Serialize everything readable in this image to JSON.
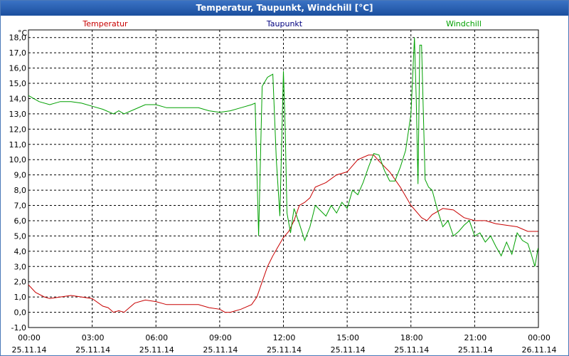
{
  "window": {
    "title": "Temperatur, Taupunkt, Windchill [°C]"
  },
  "colors": {
    "temperatur": "#c80000",
    "taupunkt": "#00007f",
    "windchill": "#00a000",
    "grid": "#000000"
  },
  "chart_data": {
    "type": "line",
    "title": "Temperatur, Taupunkt, Windchill [°C]",
    "ylabel": "°C",
    "ylim": [
      -1,
      18.5
    ],
    "grid": true,
    "legend": "top",
    "y_ticks": [
      "-1,0",
      "0,0",
      "1,0",
      "2,0",
      "3,0",
      "4,0",
      "5,0",
      "6,0",
      "7,0",
      "8,0",
      "9,0",
      "10,0",
      "11,0",
      "12,0",
      "13,0",
      "14,0",
      "15,0",
      "16,0",
      "17,0",
      "18,0"
    ],
    "x_ticks": [
      {
        "time": "00:00",
        "date": "25.11.14"
      },
      {
        "time": "03:00",
        "date": "25.11.14"
      },
      {
        "time": "06:00",
        "date": "25.11.14"
      },
      {
        "time": "09:00",
        "date": "25.11.14"
      },
      {
        "time": "12:00",
        "date": "25.11.14"
      },
      {
        "time": "15:00",
        "date": "25.11.14"
      },
      {
        "time": "18:00",
        "date": "25.11.14"
      },
      {
        "time": "21:00",
        "date": "25.11.14"
      },
      {
        "time": "00:00",
        "date": "26.11.14"
      }
    ],
    "series": [
      {
        "name": "Temperatur",
        "points": [
          [
            "25.11.14 00:00",
            1.8
          ],
          [
            "25.11.14 00:20",
            1.3
          ],
          [
            "25.11.14 00:45",
            1.0
          ],
          [
            "25.11.14 01:00",
            0.9
          ],
          [
            "25.11.14 01:30",
            1.0
          ],
          [
            "25.11.14 02:00",
            1.1
          ],
          [
            "25.11.14 02:30",
            1.0
          ],
          [
            "25.11.14 03:00",
            0.9
          ],
          [
            "25.11.14 03:30",
            0.4
          ],
          [
            "25.11.14 03:45",
            0.3
          ],
          [
            "25.11.14 04:00",
            0.0
          ],
          [
            "25.11.14 04:15",
            0.1
          ],
          [
            "25.11.14 04:30",
            0.0
          ],
          [
            "25.11.14 04:45",
            0.3
          ],
          [
            "25.11.14 05:00",
            0.6
          ],
          [
            "25.11.14 05:30",
            0.8
          ],
          [
            "25.11.14 06:00",
            0.7
          ],
          [
            "25.11.14 06:30",
            0.5
          ],
          [
            "25.11.14 07:00",
            0.5
          ],
          [
            "25.11.14 07:30",
            0.5
          ],
          [
            "25.11.14 08:00",
            0.5
          ],
          [
            "25.11.14 08:30",
            0.3
          ],
          [
            "25.11.14 09:00",
            0.2
          ],
          [
            "25.11.14 09:15",
            0.0
          ],
          [
            "25.11.14 09:30",
            0.0
          ],
          [
            "25.11.14 10:00",
            0.2
          ],
          [
            "25.11.14 10:30",
            0.5
          ],
          [
            "25.11.14 10:45",
            1.0
          ],
          [
            "25.11.14 11:00",
            2.0
          ],
          [
            "25.11.14 11:15",
            3.0
          ],
          [
            "25.11.14 11:30",
            3.7
          ],
          [
            "25.11.14 11:45",
            4.3
          ],
          [
            "25.11.14 12:00",
            4.9
          ],
          [
            "25.11.14 12:15",
            5.3
          ],
          [
            "25.11.14 12:30",
            6.0
          ],
          [
            "25.11.14 12:45",
            7.0
          ],
          [
            "25.11.14 13:00",
            7.2
          ],
          [
            "25.11.14 13:15",
            7.5
          ],
          [
            "25.11.14 13:30",
            8.2
          ],
          [
            "25.11.14 14:00",
            8.5
          ],
          [
            "25.11.14 14:30",
            9.0
          ],
          [
            "25.11.14 15:00",
            9.2
          ],
          [
            "25.11.14 15:30",
            10.0
          ],
          [
            "25.11.14 16:00",
            10.3
          ],
          [
            "25.11.14 16:15",
            10.3
          ],
          [
            "25.11.14 16:30",
            9.9
          ],
          [
            "25.11.14 17:00",
            9.2
          ],
          [
            "25.11.14 17:30",
            8.2
          ],
          [
            "25.11.14 18:00",
            7.0
          ],
          [
            "25.11.14 18:30",
            6.2
          ],
          [
            "25.11.14 18:45",
            6.0
          ],
          [
            "25.11.14 19:00",
            6.4
          ],
          [
            "25.11.14 19:30",
            6.8
          ],
          [
            "25.11.14 20:00",
            6.7
          ],
          [
            "25.11.14 20:30",
            6.2
          ],
          [
            "25.11.14 21:00",
            6.0
          ],
          [
            "25.11.14 21:30",
            6.0
          ],
          [
            "25.11.14 22:00",
            5.8
          ],
          [
            "25.11.14 22:30",
            5.7
          ],
          [
            "25.11.14 23:00",
            5.6
          ],
          [
            "25.11.14 23:30",
            5.3
          ],
          [
            "25.11.14 23:59",
            5.3
          ]
        ]
      },
      {
        "name": "Taupunkt",
        "points": []
      },
      {
        "name": "Windchill",
        "points": [
          [
            "25.11.14 00:00",
            14.2
          ],
          [
            "25.11.14 00:30",
            13.8
          ],
          [
            "25.11.14 01:00",
            13.6
          ],
          [
            "25.11.14 01:30",
            13.8
          ],
          [
            "25.11.14 02:00",
            13.8
          ],
          [
            "25.11.14 02:30",
            13.7
          ],
          [
            "25.11.14 03:00",
            13.5
          ],
          [
            "25.11.14 03:30",
            13.3
          ],
          [
            "25.11.14 04:00",
            13.0
          ],
          [
            "25.11.14 04:15",
            13.2
          ],
          [
            "25.11.14 04:30",
            13.0
          ],
          [
            "25.11.14 05:00",
            13.3
          ],
          [
            "25.11.14 05:30",
            13.6
          ],
          [
            "25.11.14 06:00",
            13.6
          ],
          [
            "25.11.14 06:30",
            13.4
          ],
          [
            "25.11.14 07:00",
            13.4
          ],
          [
            "25.11.14 07:30",
            13.4
          ],
          [
            "25.11.14 08:00",
            13.4
          ],
          [
            "25.11.14 08:30",
            13.2
          ],
          [
            "25.11.14 09:00",
            13.1
          ],
          [
            "25.11.14 09:30",
            13.2
          ],
          [
            "25.11.14 10:00",
            13.4
          ],
          [
            "25.11.14 10:30",
            13.6
          ],
          [
            "25.11.14 10:40",
            13.7
          ],
          [
            "25.11.14 10:50",
            5.0
          ],
          [
            "25.11.14 11:00",
            14.8
          ],
          [
            "25.11.14 11:15",
            15.4
          ],
          [
            "25.11.14 11:30",
            15.6
          ],
          [
            "25.11.14 11:40",
            10.0
          ],
          [
            "25.11.14 11:50",
            6.3
          ],
          [
            "25.11.14 12:00",
            15.8
          ],
          [
            "25.11.14 12:05",
            12.0
          ],
          [
            "25.11.14 12:10",
            6.5
          ],
          [
            "25.11.14 12:20",
            5.2
          ],
          [
            "25.11.14 12:30",
            6.8
          ],
          [
            "25.11.14 12:45",
            5.8
          ],
          [
            "25.11.14 13:00",
            4.7
          ],
          [
            "25.11.14 13:15",
            5.6
          ],
          [
            "25.11.14 13:30",
            7.0
          ],
          [
            "25.11.14 14:00",
            6.3
          ],
          [
            "25.11.14 14:15",
            7.0
          ],
          [
            "25.11.14 14:30",
            6.5
          ],
          [
            "25.11.14 14:45",
            7.2
          ],
          [
            "25.11.14 15:00",
            6.8
          ],
          [
            "25.11.14 15:15",
            8.0
          ],
          [
            "25.11.14 15:30",
            7.7
          ],
          [
            "25.11.14 15:45",
            8.5
          ],
          [
            "25.11.14 16:00",
            9.5
          ],
          [
            "25.11.14 16:15",
            10.4
          ],
          [
            "25.11.14 16:30",
            10.3
          ],
          [
            "25.11.14 16:45",
            9.3
          ],
          [
            "25.11.14 17:00",
            8.6
          ],
          [
            "25.11.14 17:15",
            8.6
          ],
          [
            "25.11.14 17:30",
            9.5
          ],
          [
            "25.11.14 17:45",
            10.6
          ],
          [
            "25.11.14 18:00",
            13.0
          ],
          [
            "25.11.14 18:10",
            18.0
          ],
          [
            "25.11.14 18:15",
            14.0
          ],
          [
            "25.11.14 18:20",
            8.4
          ],
          [
            "25.11.14 18:25",
            17.5
          ],
          [
            "25.11.14 18:30",
            17.5
          ],
          [
            "25.11.14 18:40",
            8.7
          ],
          [
            "25.11.14 18:50",
            8.2
          ],
          [
            "25.11.14 19:00",
            8.0
          ],
          [
            "25.11.14 19:15",
            6.7
          ],
          [
            "25.11.14 19:30",
            5.6
          ],
          [
            "25.11.14 19:45",
            6.0
          ],
          [
            "25.11.14 20:00",
            5.0
          ],
          [
            "25.11.14 20:15",
            5.3
          ],
          [
            "25.11.14 20:30",
            5.7
          ],
          [
            "25.11.14 20:45",
            6.0
          ],
          [
            "25.11.14 21:00",
            5.0
          ],
          [
            "25.11.14 21:15",
            5.2
          ],
          [
            "25.11.14 21:30",
            4.6
          ],
          [
            "25.11.14 21:45",
            5.0
          ],
          [
            "25.11.14 22:00",
            4.3
          ],
          [
            "25.11.14 22:15",
            3.7
          ],
          [
            "25.11.14 22:30",
            4.6
          ],
          [
            "25.11.14 22:45",
            3.8
          ],
          [
            "25.11.14 23:00",
            5.2
          ],
          [
            "25.11.14 23:15",
            4.7
          ],
          [
            "25.11.14 23:30",
            4.5
          ],
          [
            "25.11.14 23:40",
            3.8
          ],
          [
            "25.11.14 23:50",
            3.0
          ],
          [
            "25.11.14 23:59",
            4.2
          ]
        ]
      }
    ]
  }
}
